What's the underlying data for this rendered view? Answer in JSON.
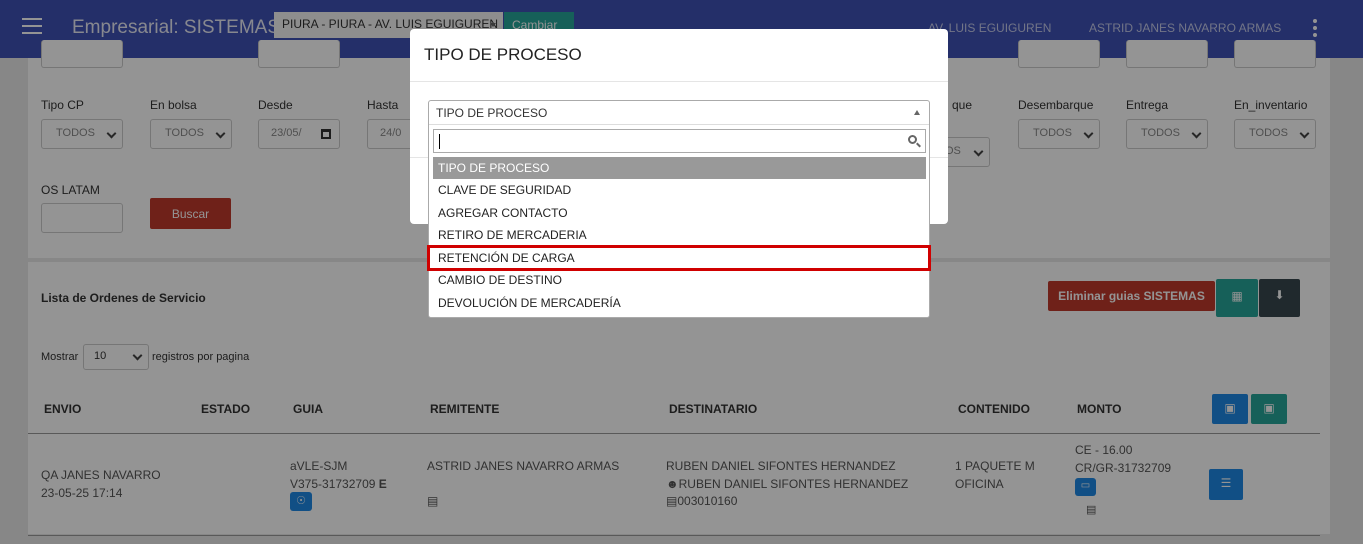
{
  "header": {
    "app_title": "Empresarial: SISTEMAS",
    "branch": "PIURA - PIURA - AV. LUIS EGUIGUREN",
    "change_button": "Cambiar",
    "branch_short": "AV. LUIS EGUIGUREN",
    "user": "ASTRID JANES NAVARRO ARMAS"
  },
  "filters": [
    {
      "label": "Tipo CP",
      "value": "TODOS"
    },
    {
      "label": "En bolsa",
      "value": "TODOS"
    },
    {
      "label": "Desde",
      "value": "23/05/"
    },
    {
      "label": "Hasta",
      "value": "24/0"
    },
    {
      "label": "que",
      "value": "OS"
    },
    {
      "label": "Desembarque",
      "value": "TODOS"
    },
    {
      "label": "Entrega",
      "value": "TODOS"
    },
    {
      "label": "En_inventario",
      "value": "TODOS"
    }
  ],
  "os_latam_label": "OS LATAM",
  "search_button": "Buscar",
  "list": {
    "title": "Lista de Ordenes de Servicio",
    "delete_button": "Eliminar guias SISTEMAS",
    "show_label": "Mostrar",
    "page_size": "10",
    "per_page_label": "registros por pagina",
    "columns": [
      "ENVIO",
      "ESTADO",
      "GUIA",
      "REMITENTE",
      "DESTINATARIO",
      "CONTENIDO",
      "MONTO"
    ],
    "row": {
      "envio": [
        "QA JANES NAVARRO",
        "23-05-25 17:14"
      ],
      "guia": [
        "aVLE-SJM",
        "V375-31732709"
      ],
      "guia_symbol": "E",
      "remitente": "ASTRID JANES NAVARRO ARMAS",
      "destinatario": [
        "RUBEN DANIEL SIFONTES HERNANDEZ",
        "RUBEN DANIEL SIFONTES HERNANDEZ",
        "003010160"
      ],
      "contenido": [
        "1 PAQUETE M",
        "OFICINA"
      ],
      "monto": [
        "CE - 16.00",
        "CR/GR-31732709"
      ]
    }
  },
  "modal": {
    "title": "TIPO DE PROCESO",
    "selected": "TIPO DE PROCESO",
    "search_value": "",
    "options": [
      "TIPO DE PROCESO",
      "CLAVE DE SEGURIDAD",
      "AGREGAR CONTACTO",
      "RETIRO DE MERCADERIA",
      "RETENCIÓN DE CARGA",
      "CAMBIO DE DESTINO",
      "DEVOLUCIÓN DE MERCADERÍA"
    ]
  },
  "colors": {
    "topbar": "#3f51b5",
    "teal": "#26a69a",
    "danger": "#c0392b",
    "highlight_box": "#d00000"
  }
}
